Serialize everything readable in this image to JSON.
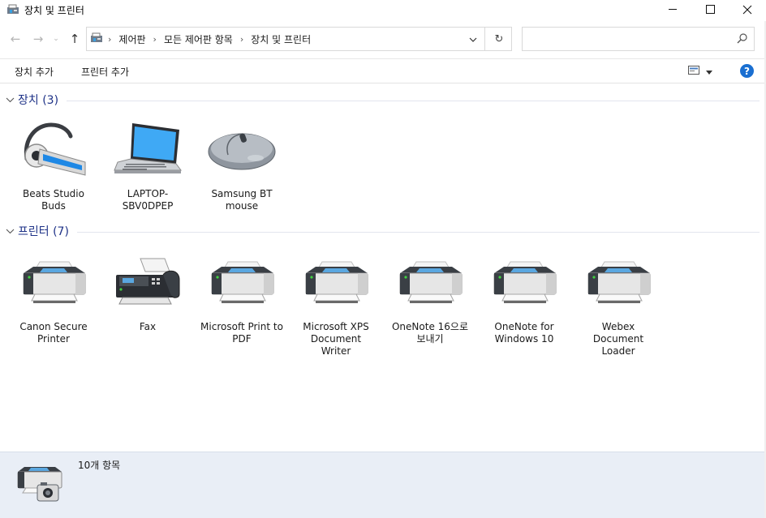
{
  "window": {
    "title": "장치 및 프린터",
    "icon": "devices-printers-icon"
  },
  "nav": {
    "breadcrumbs": [
      "제어판",
      "모든 제어판 항목",
      "장치 및 프린터"
    ],
    "search_placeholder": ""
  },
  "toolbar": {
    "add_device": "장치 추가",
    "add_printer": "프린터 추가"
  },
  "groups": {
    "devices": {
      "title": "장치 (3)",
      "items": [
        {
          "label": "Beats Studio Buds",
          "icon": "headset-icon"
        },
        {
          "label": "LAPTOP-SBV0DPEP",
          "icon": "laptop-icon"
        },
        {
          "label": "Samsung BT mouse",
          "icon": "mouse-icon"
        }
      ]
    },
    "printers": {
      "title": "프린터 (7)",
      "items": [
        {
          "label": "Canon Secure Printer",
          "icon": "printer-icon"
        },
        {
          "label": "Fax",
          "icon": "fax-icon"
        },
        {
          "label": "Microsoft Print to PDF",
          "icon": "printer-icon"
        },
        {
          "label": "Microsoft XPS Document Writer",
          "icon": "printer-icon"
        },
        {
          "label": "OneNote 16으로 보내기",
          "icon": "printer-icon"
        },
        {
          "label": "OneNote for Windows 10",
          "icon": "printer-icon"
        },
        {
          "label": "Webex Document Loader",
          "icon": "printer-icon"
        }
      ]
    }
  },
  "details": {
    "count": "10개 항목"
  },
  "colors": {
    "group_title": "#1e3287",
    "details_bg": "#e9eef6",
    "help": "#1a6fd1"
  }
}
